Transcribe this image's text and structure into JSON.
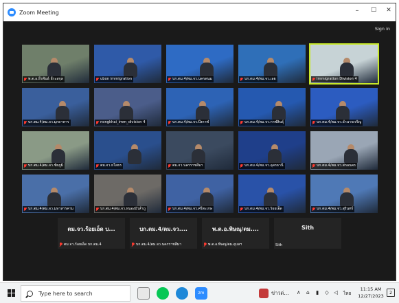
{
  "window": {
    "title": "Zoom Meeting",
    "minimize": "–",
    "maximize": "☐",
    "close": "✕",
    "signin": "Sign in"
  },
  "tiles": [
    {
      "name": "พ.ต.อ.ธีรพันธ์ ธีระสกุล",
      "bg": "#6f7f6a"
    },
    {
      "name": "ubon immigration",
      "bg": "#2f5aa8"
    },
    {
      "name": "บก.ตม.4/ตม.จว.นครพนม",
      "bg": "#2e6bc4"
    },
    {
      "name": "บก.ตม.4/ตม.จว.เลย",
      "bg": "#2f6fb8"
    },
    {
      "name": "Immigration Division 4",
      "bg": "#c7d3d6"
    },
    {
      "name": "บก.ตม.4/ตม.จว.มุกดาหาร",
      "bg": "#3a5f9c"
    },
    {
      "name": "nongkhai_imm_division 4",
      "bg": "#4b5d8a"
    },
    {
      "name": "บก.ตม.4/ตม.จว.บึงกาฬ",
      "bg": "#2d63b5"
    },
    {
      "name": "บก.ตม.4/ตม.จว.กาฬสินธุ์",
      "bg": "#2559b0"
    },
    {
      "name": "บก.ตม.4/ตม.จว.อำนาจเจริญ",
      "bg": "#2c5cc0"
    },
    {
      "name": "บก.ตม.4/ตม.จว.ชัยภูมิ",
      "bg": "#8a9a86"
    },
    {
      "name": "ตม.จว.ยโสธร",
      "bg": "#2a4f8d"
    },
    {
      "name": "ตม.จว.นครราชสีมา",
      "bg": "#3b4a5f"
    },
    {
      "name": "บก.ตม.4/ตม.จว.อุดรธานี",
      "bg": "#1f3f8a"
    },
    {
      "name": "บก.ตม.4/ตม.จว.สกลนคร",
      "bg": "#9aa6b5"
    },
    {
      "name": "บก.ตม.4/ตม.จว.มหาสารคาม",
      "bg": "#4a6fa8"
    },
    {
      "name": "บก.ตม.4/ตม.จว.หนองบัวลำภู",
      "bg": "#6d6a66"
    },
    {
      "name": "บก.ตม.4/ตม.จว.ศรีสะเกษ",
      "bg": "#3f62a3"
    },
    {
      "name": "บก.ตม.4/ตม.จว.ร้อยเอ็ด",
      "bg": "#2952a8"
    },
    {
      "name": "บก.ตม.4/ตม.จว.สุรินทร์",
      "bg": "#4f79b6"
    }
  ],
  "namecards": [
    {
      "big": "ตม.จว.ร้อยเอ็ด บ...",
      "name": "ตม.จว.ร้อยเอ็ด บก.ตม.4"
    },
    {
      "big": "บก.ตม.4/ตม.จว....",
      "name": "บก.ตม.4/ตม.จว.นครราชสีมา"
    },
    {
      "big": "พ.ต.อ.พิษณุ/ตม....",
      "name": "พ.ต.อ.พิษณุ/ตม.อุบลฯ"
    },
    {
      "big": "Sith",
      "name": "Sith"
    }
  ],
  "taskbar": {
    "search_placeholder": "Type here to search",
    "tray_news": "ข่าวด่...",
    "tray_lang": "ไทย",
    "time": "11:15 AM",
    "date": "12/27/2023",
    "notifications": "2"
  },
  "colors": {
    "window_bg": "#1a1a1a",
    "active_speaker": "#c7e829",
    "zoom_blue": "#2d8cff"
  }
}
